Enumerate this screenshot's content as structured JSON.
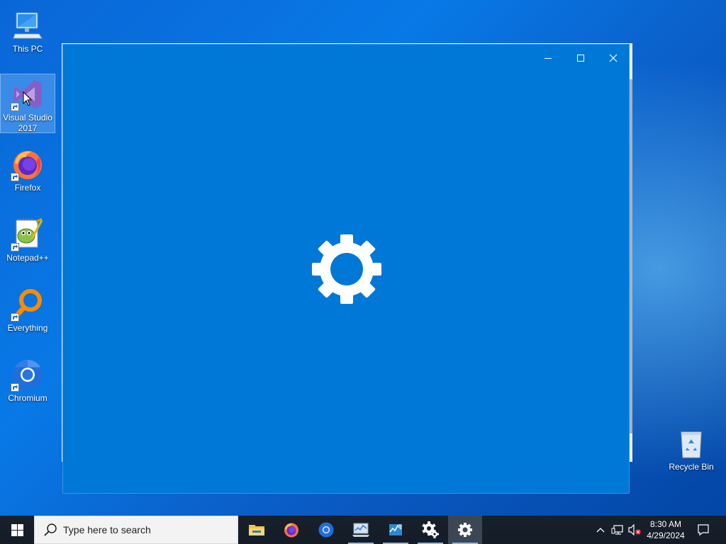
{
  "desktop": {
    "icons": [
      {
        "label": "This PC",
        "icon": "computer-icon",
        "shortcut": false
      },
      {
        "label": "Visual Studio 2017",
        "icon": "visual-studio-icon",
        "shortcut": true,
        "selected": true
      },
      {
        "label": "Firefox",
        "icon": "firefox-icon",
        "shortcut": true
      },
      {
        "label": "Notepad++",
        "icon": "notepadpp-icon",
        "shortcut": true
      },
      {
        "label": "Everything",
        "icon": "everything-icon",
        "shortcut": true
      },
      {
        "label": "Chromium",
        "icon": "chromium-icon",
        "shortcut": true
      },
      {
        "label": "Recycle Bin",
        "icon": "recycle-bin-icon",
        "shortcut": false
      }
    ]
  },
  "window": {
    "app": "Settings",
    "splash_icon": "gear-icon",
    "background_color": "#0078d7",
    "controls": {
      "minimize_icon": "minimize-icon",
      "maximize_icon": "maximize-icon",
      "close_icon": "close-icon"
    }
  },
  "taskbar": {
    "search_placeholder": "Type here to search",
    "apps": [
      {
        "name": "File Explorer",
        "icon": "folder-icon",
        "running": false
      },
      {
        "name": "Firefox",
        "icon": "firefox-icon",
        "running": false
      },
      {
        "name": "Chromium",
        "icon": "chromium-icon",
        "running": false
      },
      {
        "name": "Resource Monitor",
        "icon": "monitor-icon",
        "running": true
      },
      {
        "name": "Task Manager",
        "icon": "task-manager-icon",
        "running": true
      },
      {
        "name": "Settings",
        "icon": "gear-icon",
        "running": true
      },
      {
        "name": "Settings",
        "icon": "gear-icon",
        "running": true,
        "active": true
      }
    ],
    "tray": {
      "chevron_icon": "chevron-up-icon",
      "network_icon": "network-icon",
      "volume_icon": "volume-muted-icon"
    },
    "time": "8:30 AM",
    "date": "4/29/2024",
    "notifications_icon": "action-center-icon"
  }
}
